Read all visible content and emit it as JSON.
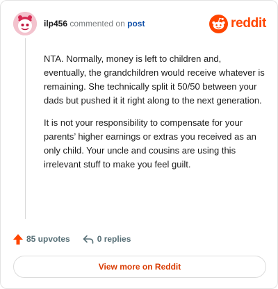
{
  "header": {
    "username": "ilp456",
    "commented_text": "commented on",
    "post_link": "post",
    "brand": "reddit",
    "brand_color": "#ff4500"
  },
  "comment": {
    "paragraphs": [
      "NTA. Normally, money is left to children and, eventually, the grandchildren would receive whatever is remaining. She technically split it 50/50 between your dads but pushed it it right along to the next generation.",
      "It is not your responsibility to compensate for your parents’ higher earnings or extras you received as an only child. Your uncle and cousins are using this irrelevant stuff to make you feel guilt."
    ]
  },
  "actions": {
    "upvotes": "85 upvotes",
    "upvote_icon": "upvote-arrow-icon",
    "replies": "0 replies",
    "reply_icon": "reply-arrow-icon"
  },
  "footer": {
    "view_more": "View more on Reddit"
  },
  "colors": {
    "accent": "#ff4500",
    "link": "#0f4fa8",
    "view_more_text": "#d93a00"
  }
}
